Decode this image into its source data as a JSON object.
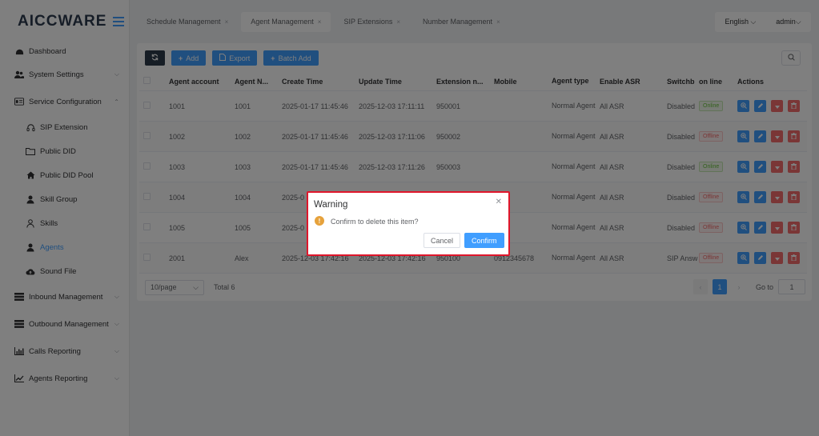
{
  "app": {
    "logo": "AICCWARE"
  },
  "sidebar": {
    "items": [
      {
        "label": "Dashboard",
        "icon": "dashboard-icon"
      },
      {
        "label": "System Settings",
        "icon": "users-icon"
      },
      {
        "label": "Service Configuration",
        "icon": "id-card-icon"
      },
      {
        "label": "SIP Extension",
        "icon": "headset-icon"
      },
      {
        "label": "Public DID",
        "icon": "folder-icon"
      },
      {
        "label": "Public DID Pool",
        "icon": "home-icon"
      },
      {
        "label": "Skill Group",
        "icon": "user-tie-icon"
      },
      {
        "label": "Skills",
        "icon": "user-outline-icon"
      },
      {
        "label": "Agents",
        "icon": "user-icon"
      },
      {
        "label": "Sound File",
        "icon": "cloud-upload-icon"
      },
      {
        "label": "Inbound Management",
        "icon": "list-icon"
      },
      {
        "label": "Outbound Management",
        "icon": "list-icon"
      },
      {
        "label": "Calls Reporting",
        "icon": "bar-chart-icon"
      },
      {
        "label": "Agents Reporting",
        "icon": "line-chart-icon"
      }
    ]
  },
  "tabs": [
    {
      "label": "Schedule Management"
    },
    {
      "label": "Agent Management"
    },
    {
      "label": "SIP Extensions"
    },
    {
      "label": "Number Management"
    }
  ],
  "header": {
    "language": "English",
    "user": "admin"
  },
  "toolbar": {
    "add": "Add",
    "export": "Export",
    "batch_add": "Batch Add"
  },
  "table": {
    "columns": [
      "Agent account",
      "Agent N...",
      "Create Time",
      "Update Time",
      "Extension n...",
      "Mobile",
      "Agent type",
      "Enable ASR",
      "Switchb",
      "on line",
      "Actions"
    ],
    "rows": [
      {
        "account": "1001",
        "name": "1001",
        "create": "2025-01-17 11:45:46",
        "update": "2025-12-03 17:11:11",
        "ext": "950001",
        "mobile": "",
        "type": "Normal Agent",
        "asr": "All ASR",
        "switch": "Disabled",
        "online": "Online"
      },
      {
        "account": "1002",
        "name": "1002",
        "create": "2025-01-17 11:45:46",
        "update": "2025-12-03 17:11:06",
        "ext": "950002",
        "mobile": "",
        "type": "Normal Agent",
        "asr": "All ASR",
        "switch": "Disabled",
        "online": "Offline"
      },
      {
        "account": "1003",
        "name": "1003",
        "create": "2025-01-17 11:45:46",
        "update": "2025-12-03 17:11:26",
        "ext": "950003",
        "mobile": "",
        "type": "Normal Agent",
        "asr": "All ASR",
        "switch": "Disabled",
        "online": "Online"
      },
      {
        "account": "1004",
        "name": "1004",
        "create": "2025-0",
        "update": "",
        "ext": "",
        "mobile": "",
        "type": "Normal Agent",
        "asr": "All ASR",
        "switch": "Disabled",
        "online": "Offline"
      },
      {
        "account": "1005",
        "name": "1005",
        "create": "2025-0",
        "update": "",
        "ext": "",
        "mobile": "",
        "type": "Normal Agent",
        "asr": "All ASR",
        "switch": "Disabled",
        "online": "Offline"
      },
      {
        "account": "2001",
        "name": "Alex",
        "create": "2025-12-03 17:42:16",
        "update": "2025-12-03 17:42:16",
        "ext": "950100",
        "mobile": "0912345678",
        "type": "Normal Agent",
        "asr": "All ASR",
        "switch": "SIP Answ",
        "online": "Offline"
      }
    ]
  },
  "pagination": {
    "page_size": "10/page",
    "total": "Total 6",
    "current": "1",
    "goto_label": "Go to",
    "goto_value": "1"
  },
  "dialog": {
    "title": "Warning",
    "message": "Confirm to delete this item?",
    "cancel": "Cancel",
    "confirm": "Confirm"
  },
  "colors": {
    "primary": "#409eff",
    "danger": "#f56c6c",
    "success": "#67c23a",
    "warning": "#e6a23c",
    "highlight": "#e0162b"
  }
}
